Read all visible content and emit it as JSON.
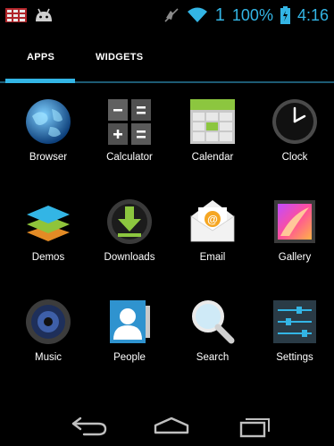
{
  "status_bar": {
    "signal_number": "1",
    "battery_percent": "100%",
    "time": "4:16",
    "accent_color": "#33b5e5",
    "icons": [
      "notification-grid-icon",
      "android-icon",
      "mute-icon",
      "wifi-icon",
      "battery-icon"
    ]
  },
  "tabs": [
    {
      "label": "APPS",
      "selected": true
    },
    {
      "label": "WIDGETS",
      "selected": false
    }
  ],
  "apps": [
    {
      "label": "Browser",
      "icon": "browser-globe-icon"
    },
    {
      "label": "Calculator",
      "icon": "calculator-icon"
    },
    {
      "label": "Calendar",
      "icon": "calendar-icon"
    },
    {
      "label": "Clock",
      "icon": "clock-icon"
    },
    {
      "label": "Demos",
      "icon": "demos-layers-icon"
    },
    {
      "label": "Downloads",
      "icon": "downloads-icon"
    },
    {
      "label": "Email",
      "icon": "email-envelope-icon"
    },
    {
      "label": "Gallery",
      "icon": "gallery-icon"
    },
    {
      "label": "Music",
      "icon": "music-speaker-icon"
    },
    {
      "label": "People",
      "icon": "people-contacts-icon"
    },
    {
      "label": "Search",
      "icon": "search-magnifier-icon"
    },
    {
      "label": "Settings",
      "icon": "settings-sliders-icon"
    }
  ],
  "nav_bar": {
    "icons": [
      "back-icon",
      "home-icon",
      "recent-apps-icon"
    ]
  }
}
